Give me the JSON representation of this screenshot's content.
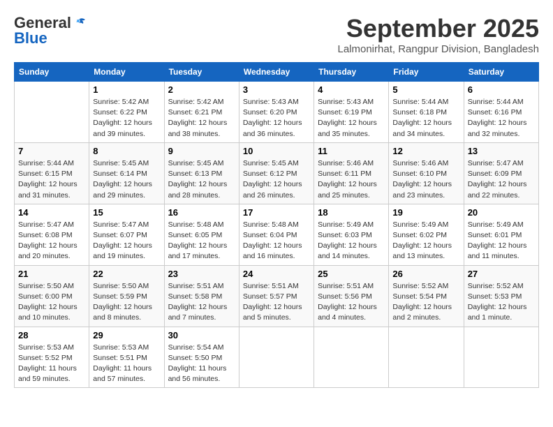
{
  "header": {
    "logo_line1": "General",
    "logo_line2": "Blue",
    "month_title": "September 2025",
    "location": "Lalmonirhat, Rangpur Division, Bangladesh"
  },
  "weekdays": [
    "Sunday",
    "Monday",
    "Tuesday",
    "Wednesday",
    "Thursday",
    "Friday",
    "Saturday"
  ],
  "weeks": [
    [
      {
        "day": "",
        "info": ""
      },
      {
        "day": "1",
        "info": "Sunrise: 5:42 AM\nSunset: 6:22 PM\nDaylight: 12 hours\nand 39 minutes."
      },
      {
        "day": "2",
        "info": "Sunrise: 5:42 AM\nSunset: 6:21 PM\nDaylight: 12 hours\nand 38 minutes."
      },
      {
        "day": "3",
        "info": "Sunrise: 5:43 AM\nSunset: 6:20 PM\nDaylight: 12 hours\nand 36 minutes."
      },
      {
        "day": "4",
        "info": "Sunrise: 5:43 AM\nSunset: 6:19 PM\nDaylight: 12 hours\nand 35 minutes."
      },
      {
        "day": "5",
        "info": "Sunrise: 5:44 AM\nSunset: 6:18 PM\nDaylight: 12 hours\nand 34 minutes."
      },
      {
        "day": "6",
        "info": "Sunrise: 5:44 AM\nSunset: 6:16 PM\nDaylight: 12 hours\nand 32 minutes."
      }
    ],
    [
      {
        "day": "7",
        "info": "Sunrise: 5:44 AM\nSunset: 6:15 PM\nDaylight: 12 hours\nand 31 minutes."
      },
      {
        "day": "8",
        "info": "Sunrise: 5:45 AM\nSunset: 6:14 PM\nDaylight: 12 hours\nand 29 minutes."
      },
      {
        "day": "9",
        "info": "Sunrise: 5:45 AM\nSunset: 6:13 PM\nDaylight: 12 hours\nand 28 minutes."
      },
      {
        "day": "10",
        "info": "Sunrise: 5:45 AM\nSunset: 6:12 PM\nDaylight: 12 hours\nand 26 minutes."
      },
      {
        "day": "11",
        "info": "Sunrise: 5:46 AM\nSunset: 6:11 PM\nDaylight: 12 hours\nand 25 minutes."
      },
      {
        "day": "12",
        "info": "Sunrise: 5:46 AM\nSunset: 6:10 PM\nDaylight: 12 hours\nand 23 minutes."
      },
      {
        "day": "13",
        "info": "Sunrise: 5:47 AM\nSunset: 6:09 PM\nDaylight: 12 hours\nand 22 minutes."
      }
    ],
    [
      {
        "day": "14",
        "info": "Sunrise: 5:47 AM\nSunset: 6:08 PM\nDaylight: 12 hours\nand 20 minutes."
      },
      {
        "day": "15",
        "info": "Sunrise: 5:47 AM\nSunset: 6:07 PM\nDaylight: 12 hours\nand 19 minutes."
      },
      {
        "day": "16",
        "info": "Sunrise: 5:48 AM\nSunset: 6:05 PM\nDaylight: 12 hours\nand 17 minutes."
      },
      {
        "day": "17",
        "info": "Sunrise: 5:48 AM\nSunset: 6:04 PM\nDaylight: 12 hours\nand 16 minutes."
      },
      {
        "day": "18",
        "info": "Sunrise: 5:49 AM\nSunset: 6:03 PM\nDaylight: 12 hours\nand 14 minutes."
      },
      {
        "day": "19",
        "info": "Sunrise: 5:49 AM\nSunset: 6:02 PM\nDaylight: 12 hours\nand 13 minutes."
      },
      {
        "day": "20",
        "info": "Sunrise: 5:49 AM\nSunset: 6:01 PM\nDaylight: 12 hours\nand 11 minutes."
      }
    ],
    [
      {
        "day": "21",
        "info": "Sunrise: 5:50 AM\nSunset: 6:00 PM\nDaylight: 12 hours\nand 10 minutes."
      },
      {
        "day": "22",
        "info": "Sunrise: 5:50 AM\nSunset: 5:59 PM\nDaylight: 12 hours\nand 8 minutes."
      },
      {
        "day": "23",
        "info": "Sunrise: 5:51 AM\nSunset: 5:58 PM\nDaylight: 12 hours\nand 7 minutes."
      },
      {
        "day": "24",
        "info": "Sunrise: 5:51 AM\nSunset: 5:57 PM\nDaylight: 12 hours\nand 5 minutes."
      },
      {
        "day": "25",
        "info": "Sunrise: 5:51 AM\nSunset: 5:56 PM\nDaylight: 12 hours\nand 4 minutes."
      },
      {
        "day": "26",
        "info": "Sunrise: 5:52 AM\nSunset: 5:54 PM\nDaylight: 12 hours\nand 2 minutes."
      },
      {
        "day": "27",
        "info": "Sunrise: 5:52 AM\nSunset: 5:53 PM\nDaylight: 12 hours\nand 1 minute."
      }
    ],
    [
      {
        "day": "28",
        "info": "Sunrise: 5:53 AM\nSunset: 5:52 PM\nDaylight: 11 hours\nand 59 minutes."
      },
      {
        "day": "29",
        "info": "Sunrise: 5:53 AM\nSunset: 5:51 PM\nDaylight: 11 hours\nand 57 minutes."
      },
      {
        "day": "30",
        "info": "Sunrise: 5:54 AM\nSunset: 5:50 PM\nDaylight: 11 hours\nand 56 minutes."
      },
      {
        "day": "",
        "info": ""
      },
      {
        "day": "",
        "info": ""
      },
      {
        "day": "",
        "info": ""
      },
      {
        "day": "",
        "info": ""
      }
    ]
  ]
}
